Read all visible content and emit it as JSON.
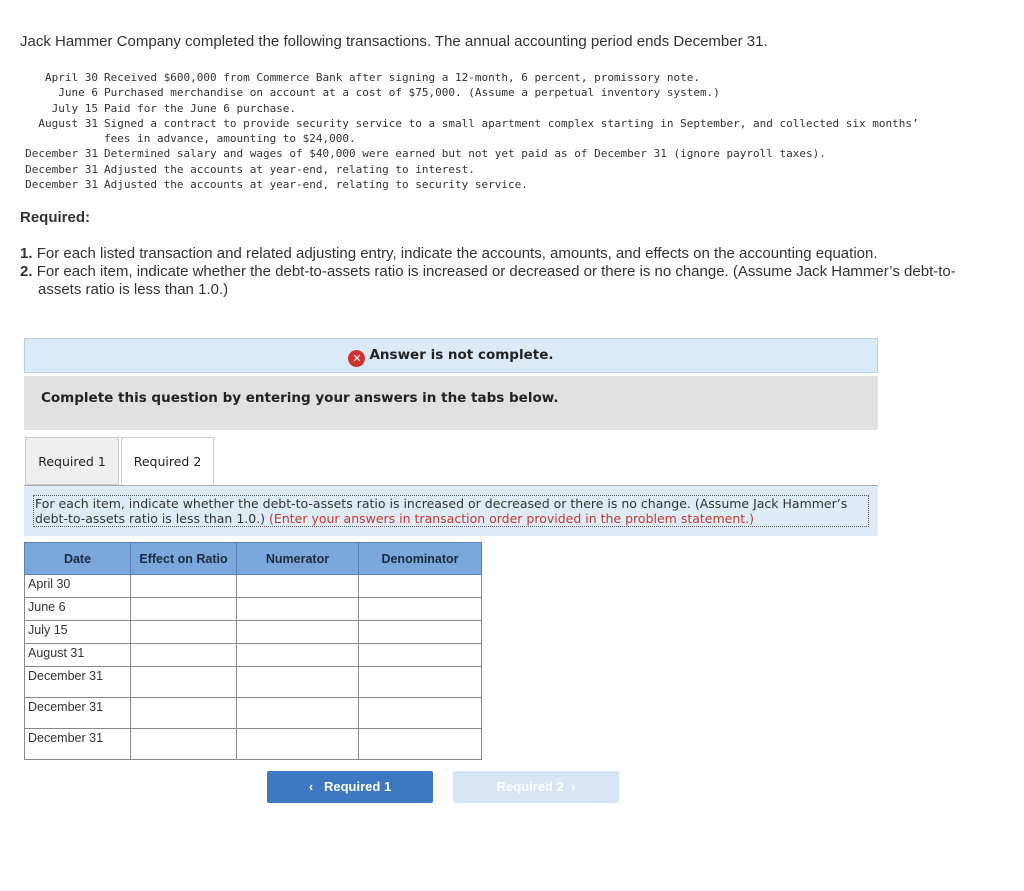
{
  "intro": "Jack Hammer Company completed the following transactions. The annual accounting period ends December 31.",
  "transactions": [
    {
      "date": "April 30",
      "desc": "Received $600,000 from Commerce Bank after signing a 12-month, 6 percent, promissory note."
    },
    {
      "date": "June 6",
      "desc": "Purchased merchandise on account at a cost of $75,000. (Assume a perpetual inventory system.)"
    },
    {
      "date": "July 15",
      "desc": "Paid for the June 6 purchase."
    },
    {
      "date": "August 31",
      "desc": "Signed a contract to provide security service to a small apartment complex starting in September, and collected six months’ fees in advance, amounting to $24,000."
    },
    {
      "date": "December 31",
      "desc": "Determined salary and wages of $40,000 were earned but not yet paid as of December 31 (ignore payroll taxes)."
    },
    {
      "date": "December 31",
      "desc": "Adjusted the accounts at year-end, relating to interest."
    },
    {
      "date": "December 31",
      "desc": "Adjusted the accounts at year-end, relating to security service."
    }
  ],
  "required_heading": "Required:",
  "required_items": [
    {
      "num": "1.",
      "text": "For each listed transaction and related adjusting entry, indicate the accounts, amounts, and effects on the accounting equation."
    },
    {
      "num": "2.",
      "text": "For each item, indicate whether the debt-to-assets ratio is increased or decreased or there is no change. (Assume Jack Hammer’s debt-to-assets ratio is less than 1.0.)"
    }
  ],
  "status": "Answer is not complete.",
  "complete_prompt": "Complete this question by entering your answers in the tabs below.",
  "tabs": [
    "Required 1",
    "Required 2"
  ],
  "active_tab": "Required 2",
  "instruction": "For each item, indicate whether the debt-to-assets ratio is increased or decreased or there is no change. (Assume Jack Hammer’s debt-to-assets ratio is less than 1.0.)",
  "instruction_note": "(Enter your answers in transaction order provided in the problem statement.)",
  "table": {
    "headers": [
      "Date",
      "Effect on Ratio",
      "Numerator",
      "Denominator"
    ],
    "rows": [
      "April 30",
      "June 6",
      "July 15",
      "August 31",
      "December 31",
      "December 31",
      "December 31"
    ]
  },
  "nav": {
    "prev": "Required 1",
    "next": "Required 2"
  },
  "colors": {
    "header": "#7ba7dd",
    "prev_button": "#3f78c2",
    "next_button_disabled": "#d8e5f4",
    "error": "#d03030"
  }
}
